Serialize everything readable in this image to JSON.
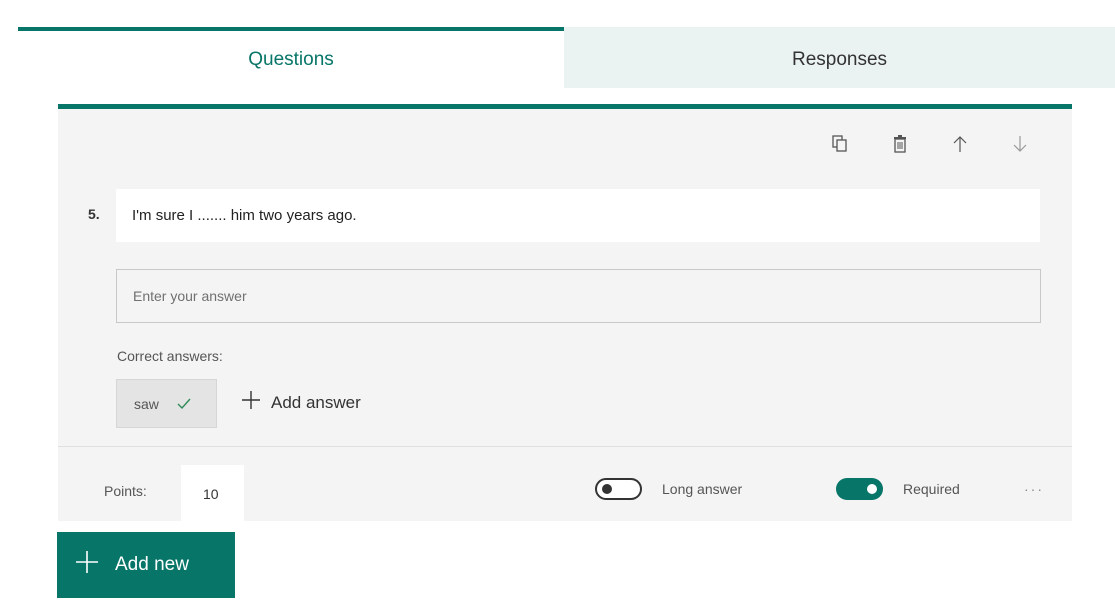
{
  "tabs": [
    {
      "label": "Questions",
      "active": true
    },
    {
      "label": "Responses",
      "active": false
    }
  ],
  "toolbar": {
    "icons": [
      "copy-icon",
      "delete-icon",
      "arrow-up-icon",
      "arrow-down-icon"
    ]
  },
  "question": {
    "number": "5.",
    "text": "I'm sure I ....... him two years ago.",
    "answer_placeholder": "Enter your answer",
    "correct_answers_label": "Correct answers:",
    "correct_answers": [
      "saw"
    ],
    "add_answer_label": "Add answer"
  },
  "footer": {
    "points_label": "Points:",
    "points_value": "10",
    "long_answer_label": "Long answer",
    "long_answer_on": false,
    "required_label": "Required",
    "required_on": true,
    "more_label": "···"
  },
  "add_new_label": "Add new",
  "colors": {
    "accent": "#077568",
    "card_bg": "#f4f4f4",
    "tab_bg": "#ebf2f2"
  }
}
